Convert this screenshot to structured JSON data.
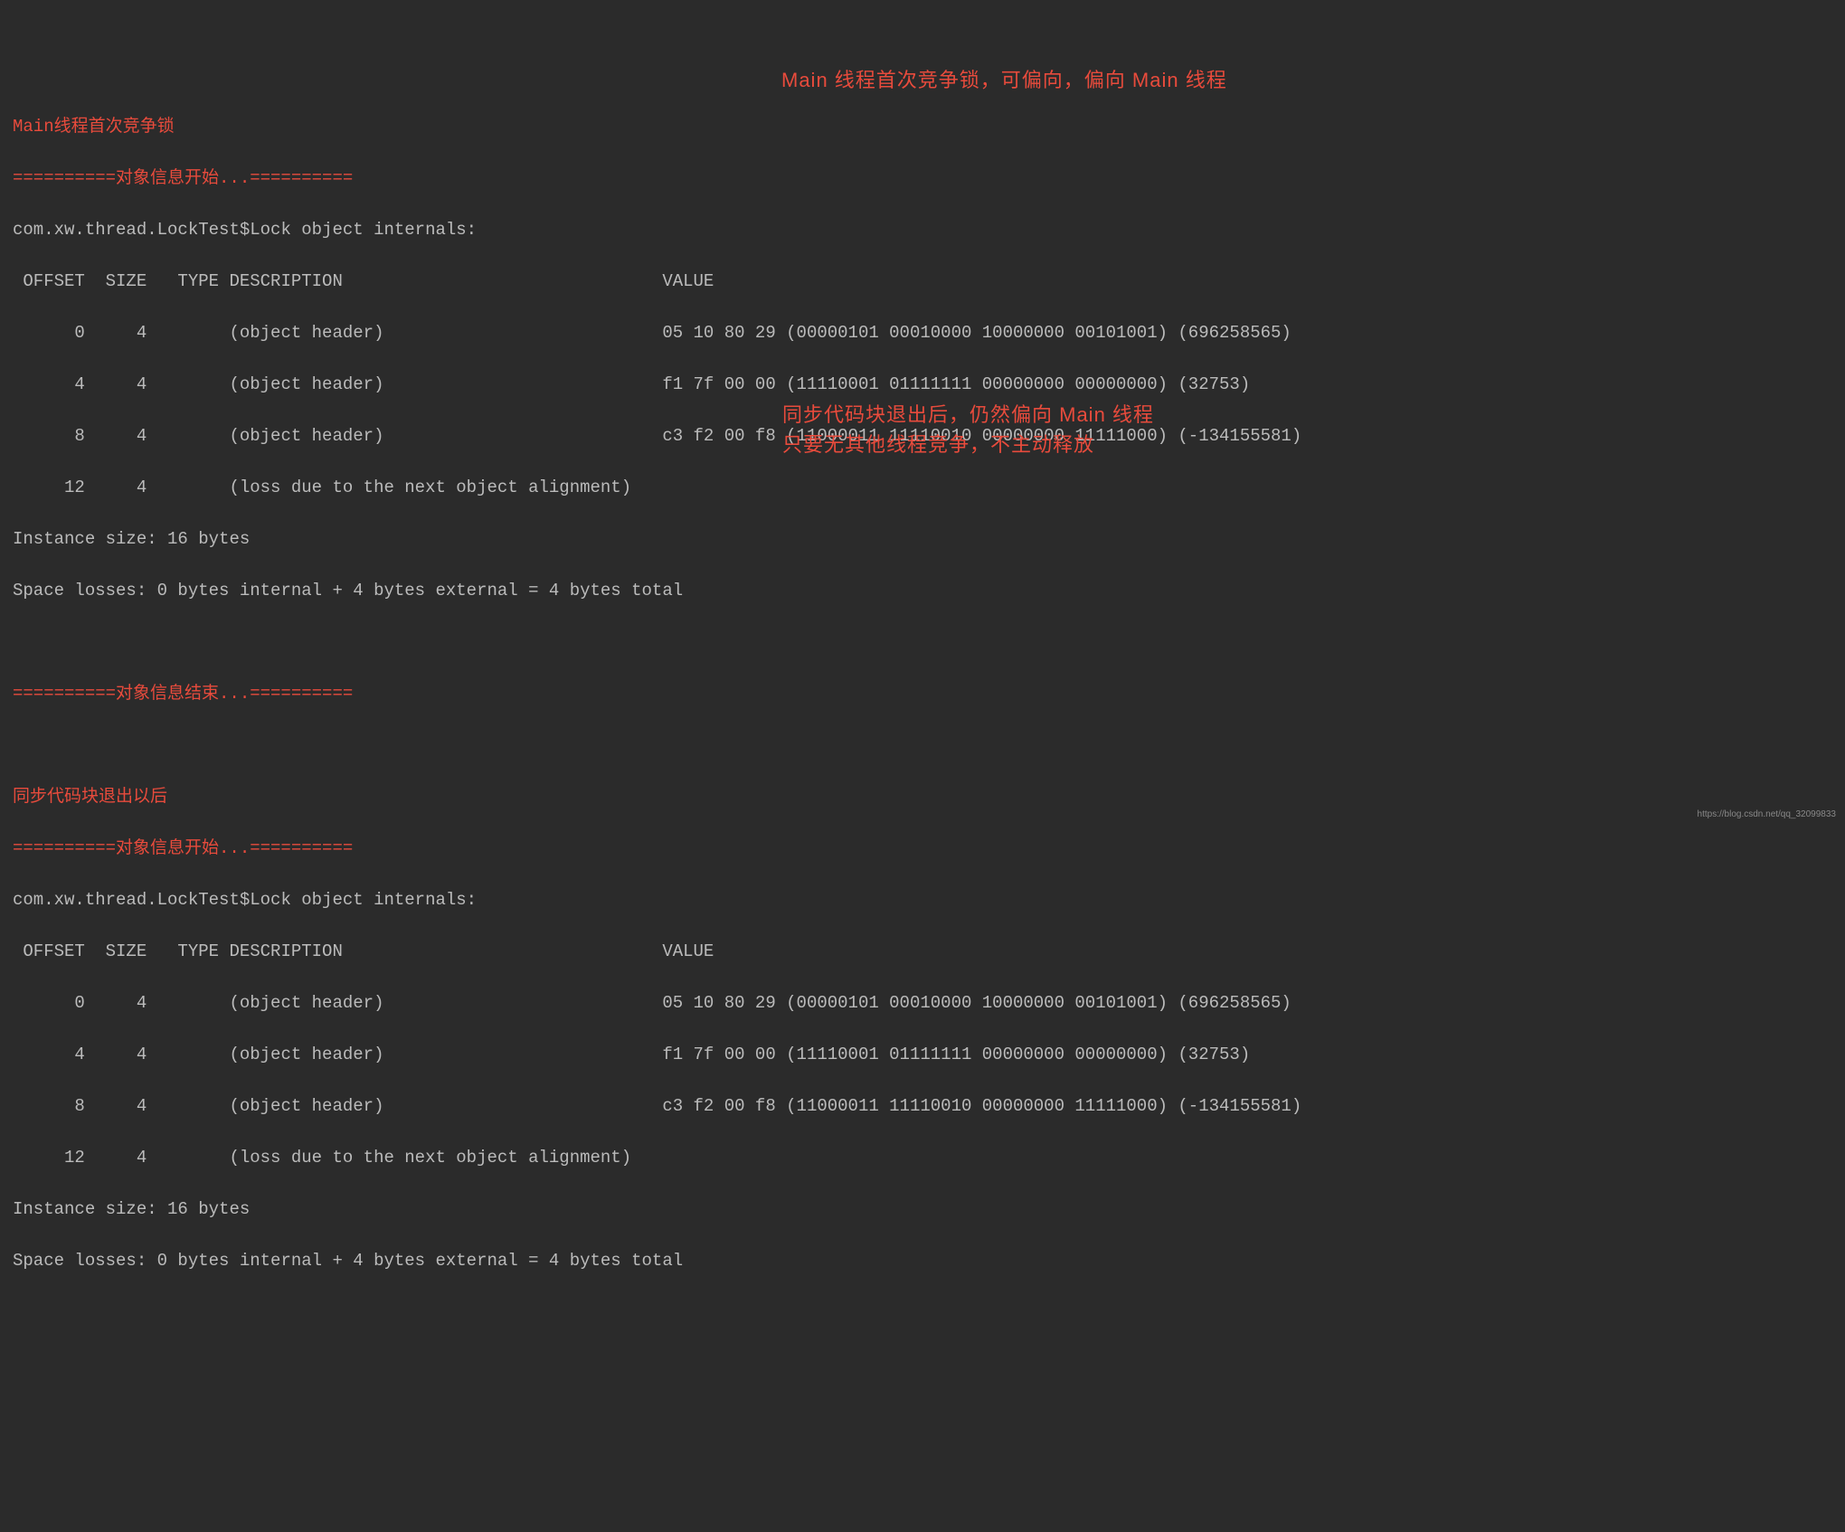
{
  "section1": {
    "title": "Main线程首次竞争锁",
    "delimiter_start": "==========对象信息开始...==========",
    "class_line": "com.xw.thread.LockTest$Lock object internals:",
    "header": " OFFSET  SIZE   TYPE DESCRIPTION                               VALUE",
    "rows": [
      "      0     4        (object header)                           05 10 80 29 (00000101 00010000 10000000 00101001) (696258565)",
      "      4     4        (object header)                           f1 7f 00 00 (11110001 01111111 00000000 00000000) (32753)",
      "      8     4        (object header)                           c3 f2 00 f8 (11000011 11110010 00000000 11111000) (-134155581)",
      "     12     4        (loss due to the next object alignment)"
    ],
    "instance_size": "Instance size: 16 bytes",
    "space_losses": "Space losses: 0 bytes internal + 4 bytes external = 4 bytes total",
    "delimiter_end": "==========对象信息结束...=========="
  },
  "section2": {
    "title": "同步代码块退出以后",
    "delimiter_start": "==========对象信息开始...==========",
    "class_line": "com.xw.thread.LockTest$Lock object internals:",
    "header": " OFFSET  SIZE   TYPE DESCRIPTION                               VALUE",
    "rows": [
      "      0     4        (object header)                           05 10 80 29 (00000101 00010000 10000000 00101001) (696258565)",
      "      4     4        (object header)                           f1 7f 00 00 (11110001 01111111 00000000 00000000) (32753)",
      "      8     4        (object header)                           c3 f2 00 f8 (11000011 11110010 00000000 11111000) (-134155581)",
      "     12     4        (loss due to the next object alignment)"
    ],
    "instance_size": "Instance size: 16 bytes",
    "space_losses": "Space losses: 0 bytes internal + 4 bytes external = 4 bytes total"
  },
  "annotations": {
    "a1": "Main 线程首次竞争锁，可偏向，偏向 Main 线程",
    "a2_line1": "同步代码块退出后，仍然偏向 Main 线程",
    "a2_line2": "只要无其他线程竞争，不主动释放"
  },
  "watermark": "https://blog.csdn.net/qq_32099833"
}
